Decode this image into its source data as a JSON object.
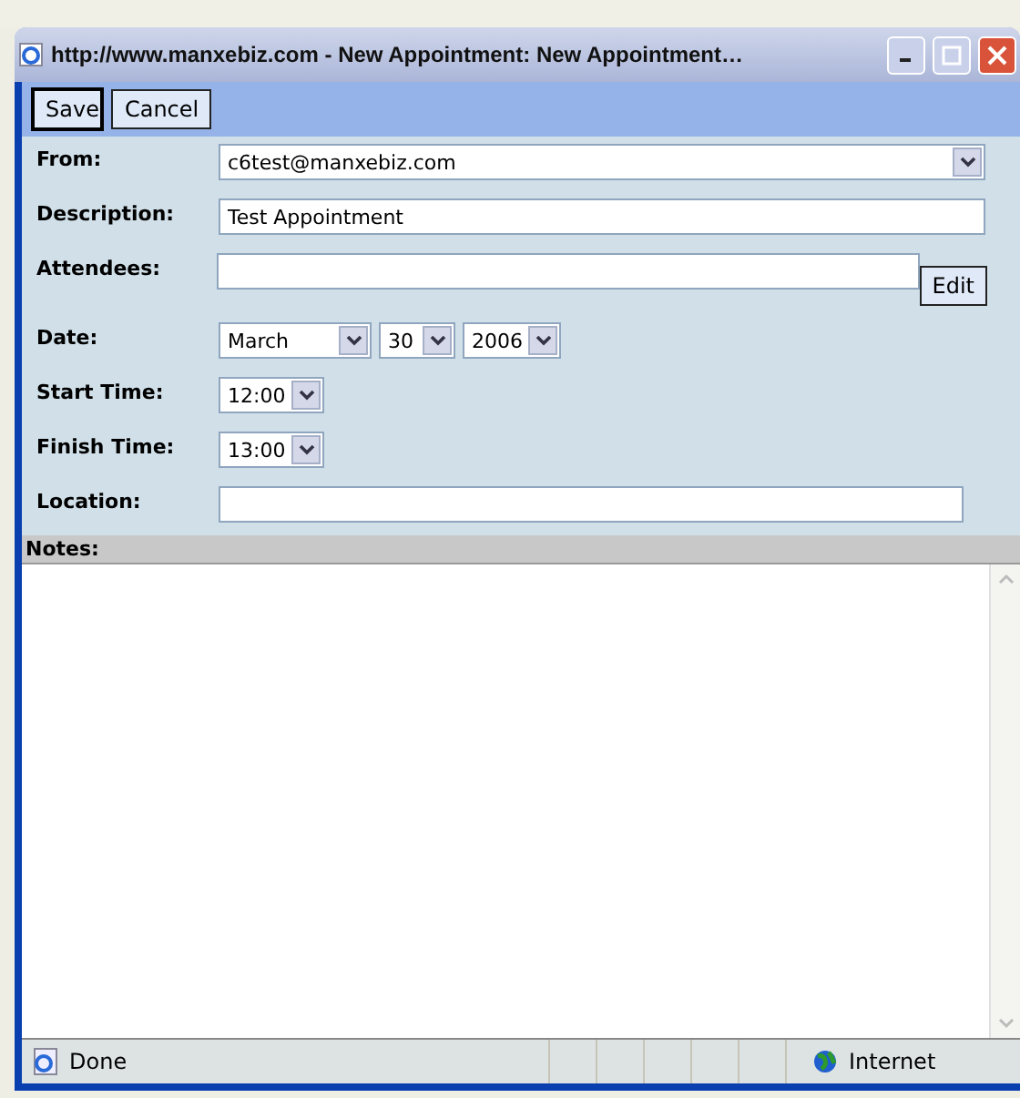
{
  "window": {
    "title": "http://www.manxebiz.com - New Appointment: New Appointment…"
  },
  "toolbar": {
    "buttons": [
      {
        "label": "Save",
        "selected": true
      },
      {
        "label": "Cancel",
        "selected": false
      }
    ]
  },
  "form": [
    {
      "kind": "select",
      "label": "From:",
      "value": "c6test@manxebiz.com"
    },
    {
      "kind": "text",
      "label": "Description:",
      "value": "Test Appointment"
    },
    {
      "kind": "attendees",
      "label": "Attendees:",
      "button": "Edit"
    },
    {
      "kind": "date",
      "label": "Date:",
      "month": "March",
      "day": "30",
      "year": "2006"
    },
    {
      "kind": "time",
      "label": "Start Time:",
      "value": "12:00"
    },
    {
      "kind": "time",
      "label": "Finish Time:",
      "value": "13:00"
    },
    {
      "kind": "location",
      "label": "Location:"
    }
  ],
  "notes": {
    "label": "Notes:"
  },
  "status_bar": {
    "status": "Done",
    "zone": "Internet"
  }
}
